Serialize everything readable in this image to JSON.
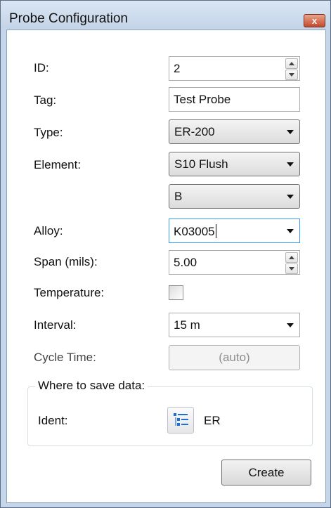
{
  "window": {
    "title": "Probe Configuration",
    "close_glyph": "x"
  },
  "form": {
    "id": {
      "label": "ID:",
      "value": "2"
    },
    "tag": {
      "label": "Tag:",
      "value": "Test Probe"
    },
    "type": {
      "label": "Type:",
      "value": "ER-200"
    },
    "element": {
      "label": "Element:",
      "value": "S10 Flush",
      "sub_value": "B"
    },
    "alloy": {
      "label": "Alloy:",
      "value": "K03005"
    },
    "span": {
      "label": "Span (mils):",
      "value": "5.00"
    },
    "temperature": {
      "label": "Temperature:",
      "checked": false
    },
    "interval": {
      "label": "Interval:",
      "value": "15 m"
    },
    "cycle_time": {
      "label": "Cycle Time:",
      "value": "(auto)",
      "enabled": false
    }
  },
  "save_group": {
    "title": "Where to save data:",
    "ident_label": "Ident:",
    "ident_icon": "list-tree-icon",
    "ident_value": "ER"
  },
  "buttons": {
    "create": "Create"
  },
  "colors": {
    "title_bar": "#c3d4e8",
    "close_button": "#c24a2d",
    "focus_border": "#3399ff",
    "icon_blue": "#1e6fd1"
  }
}
